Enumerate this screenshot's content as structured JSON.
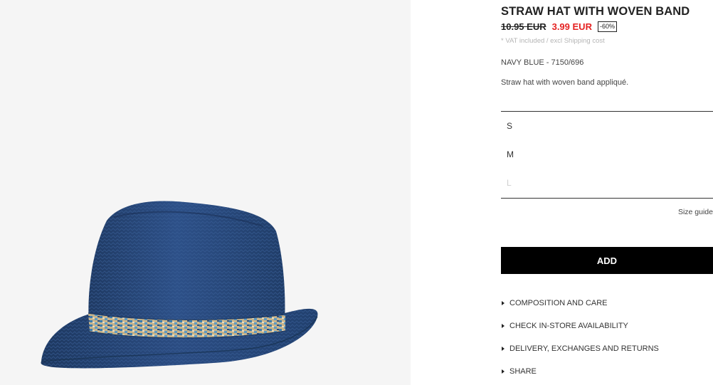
{
  "product": {
    "title": "STRAW HAT WITH WOVEN BAND",
    "old_price": "10.95 EUR",
    "new_price": "3.99 EUR",
    "discount": "-60%",
    "vat_note": "* VAT included / excl Shipping cost",
    "color_ref": "NAVY BLUE - 7150/696",
    "description": "Straw hat with woven band appliqué.",
    "image_icon": "navy-straw-fedora-hat"
  },
  "sizes": [
    {
      "label": "S",
      "available": true
    },
    {
      "label": "M",
      "available": true
    },
    {
      "label": "L",
      "available": false
    }
  ],
  "size_guide": "Size guide",
  "add_button": "ADD",
  "accordion": [
    {
      "label": "COMPOSITION AND CARE",
      "icon": "triangle-right-icon"
    },
    {
      "label": "CHECK IN-STORE AVAILABILITY",
      "icon": "triangle-right-icon"
    },
    {
      "label": "DELIVERY, EXCHANGES AND RETURNS",
      "icon": "triangle-right-icon"
    },
    {
      "label": "SHARE",
      "icon": "triangle-right-icon"
    }
  ],
  "colors": {
    "sale_price": "#e52222",
    "hat_navy": "#2a4a7c",
    "button_bg": "#000000",
    "muted_text": "#b5b5b5",
    "image_bg": "#f5f5f5"
  }
}
